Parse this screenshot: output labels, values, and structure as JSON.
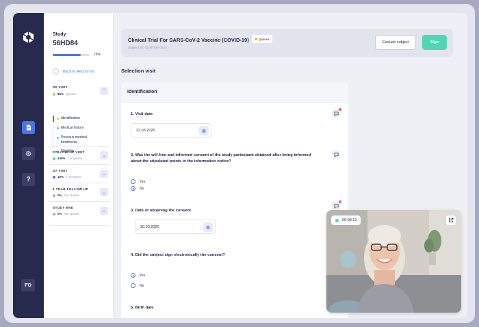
{
  "sidebar": {
    "avatar_initials": "FO",
    "icons": [
      "logo-icon",
      "document-icon",
      "gear-icon",
      "help-icon"
    ],
    "help_glyph": "?"
  },
  "study": {
    "label": "Study",
    "id": "56HD84",
    "progress": 75,
    "progress_label": "75%",
    "back_label": "Back to Record list"
  },
  "visits": [
    {
      "name": "D0 VISIT",
      "pct": "85%",
      "status": "Queries",
      "color": "#f5b83d",
      "expanded": true
    },
    {
      "name": "FOLLOW-UP VISIT",
      "pct": "100%",
      "status": "Completed",
      "color": "#4fd6b5"
    },
    {
      "name": "D7 VISIT",
      "pct": "10%",
      "status": "In progress",
      "color": "#4b74e8"
    },
    {
      "name": "1 YEAR FOLLOW UP",
      "pct": "0%",
      "status": "Not started",
      "color": "#a9adc2"
    },
    {
      "name": "STUDY END",
      "pct": "0%",
      "status": "Not started",
      "color": "#a9adc2"
    }
  ],
  "subnav": [
    {
      "label": "Identification",
      "color": "#f5b83d"
    },
    {
      "label": "Medical history",
      "color": "#4fd6b5"
    },
    {
      "label": "Previous medical treatments",
      "color": "#4fd6b5"
    },
    {
      "label": "Eligibility",
      "color": "#4fd6b5"
    }
  ],
  "header": {
    "title": "Clinical Trial For SARS-CoV-2 Vaccine (COVID-19)",
    "badge": "Queries",
    "subject": "Subject ID: CENTER-0023",
    "exclude_label": "Exclude subject",
    "sign_label": "Sign"
  },
  "section_title": "Selection visit",
  "form": {
    "title": "Identification",
    "q1": "1.   Visit date",
    "q1_value": "22.03.2020",
    "q2": "2. Was the will-free and informed consent of the study participant obtained after being informed about the stipulated points in the information notice?",
    "q2_yes": "Yes",
    "q2_no": "No",
    "q3": "3. Date of obtaining the consent",
    "q3_value": "20.03.2020",
    "q4": "4. Did the subject sign electronically the consent?",
    "q4_yes": "Yes",
    "q4_no": "No",
    "q5": "5. Birth date"
  },
  "video": {
    "timer": "00:08:13"
  },
  "colors": {
    "accent": "#4b74e8",
    "success": "#4fd6b5",
    "warning": "#f5b83d",
    "dark": "#27294d"
  }
}
